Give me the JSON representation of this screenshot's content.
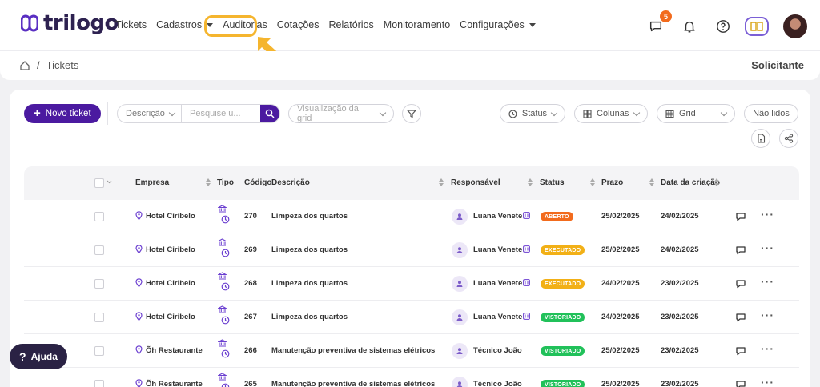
{
  "app": {
    "name": "trilogo"
  },
  "nav": {
    "items": [
      {
        "label": "Tickets",
        "has_caret": false
      },
      {
        "label": "Cadastros",
        "has_caret": true
      },
      {
        "label": "Auditorias",
        "has_caret": false
      },
      {
        "label": "Cotações",
        "has_caret": false
      },
      {
        "label": "Relatórios",
        "has_caret": false
      },
      {
        "label": "Monitoramento",
        "has_caret": false
      },
      {
        "label": "Configurações",
        "has_caret": true
      }
    ]
  },
  "header": {
    "chat_badge": "5",
    "icons": [
      "chat-icon",
      "bell-icon",
      "help-circle-icon",
      "manual-icon",
      "user-avatar"
    ]
  },
  "breadcrumb": {
    "home": "home-icon",
    "separator": "/",
    "current": "Tickets"
  },
  "role": "Solicitante",
  "toolbar": {
    "new_ticket": "Novo ticket",
    "search_field": "Descrição",
    "search_placeholder": "Pesquise u...",
    "grid_view_placeholder": "Visualização da grid",
    "status": "Status",
    "columns": "Colunas",
    "grid": "Grid",
    "unread": "Não lidos"
  },
  "table": {
    "headers": {
      "empresa": "Empresa",
      "tipo": "Tipo",
      "codigo": "Código",
      "descricao": "Descrição",
      "responsavel": "Responsável",
      "status": "Status",
      "prazo": "Prazo",
      "criacao": "Data da criação"
    },
    "rows": [
      {
        "empresa": "Hotel Ciribelo",
        "codigo": "270",
        "descricao": "Limpeza dos quartos",
        "responsavel": "Luana Venete",
        "status": "ABERTO",
        "status_color": "#f26b1d",
        "prazo": "25/02/2025",
        "criacao": "24/02/2025",
        "has_tag": true
      },
      {
        "empresa": "Hotel Ciribelo",
        "codigo": "269",
        "descricao": "Limpeza dos quartos",
        "responsavel": "Luana Venete",
        "status": "EXECUTADO",
        "status_color": "#f2b016",
        "prazo": "25/02/2025",
        "criacao": "24/02/2025",
        "has_tag": true
      },
      {
        "empresa": "Hotel Ciribelo",
        "codigo": "268",
        "descricao": "Limpeza dos quartos",
        "responsavel": "Luana Venete",
        "status": "EXECUTADO",
        "status_color": "#f2b016",
        "prazo": "24/02/2025",
        "criacao": "23/02/2025",
        "has_tag": true
      },
      {
        "empresa": "Hotel Ciribelo",
        "codigo": "267",
        "descricao": "Limpeza dos quartos",
        "responsavel": "Luana Venete",
        "status": "VISTORIADO",
        "status_color": "#21c15a",
        "prazo": "24/02/2025",
        "criacao": "23/02/2025",
        "has_tag": true
      },
      {
        "empresa": "Õh Restaurante",
        "codigo": "266",
        "descricao": "Manutenção preventiva de sistemas elétricos",
        "responsavel": "Técnico João",
        "status": "VISTORIADO",
        "status_color": "#21c15a",
        "prazo": "25/02/2025",
        "criacao": "23/02/2025",
        "has_tag": false
      },
      {
        "empresa": "Õh Restaurante",
        "codigo": "265",
        "descricao": "Manutenção preventiva de sistemas elétricos",
        "responsavel": "Técnico João",
        "status": "VISTORIADO",
        "status_color": "#21c15a",
        "prazo": "25/02/2025",
        "criacao": "23/02/2025",
        "has_tag": false
      }
    ]
  },
  "help": {
    "label": "Ajuda"
  },
  "colors": {
    "primary": "#4b1aa0",
    "highlight": "#f5b52e",
    "orange": "#f26b1d",
    "yellow": "#f2b016",
    "green": "#21c15a"
  }
}
